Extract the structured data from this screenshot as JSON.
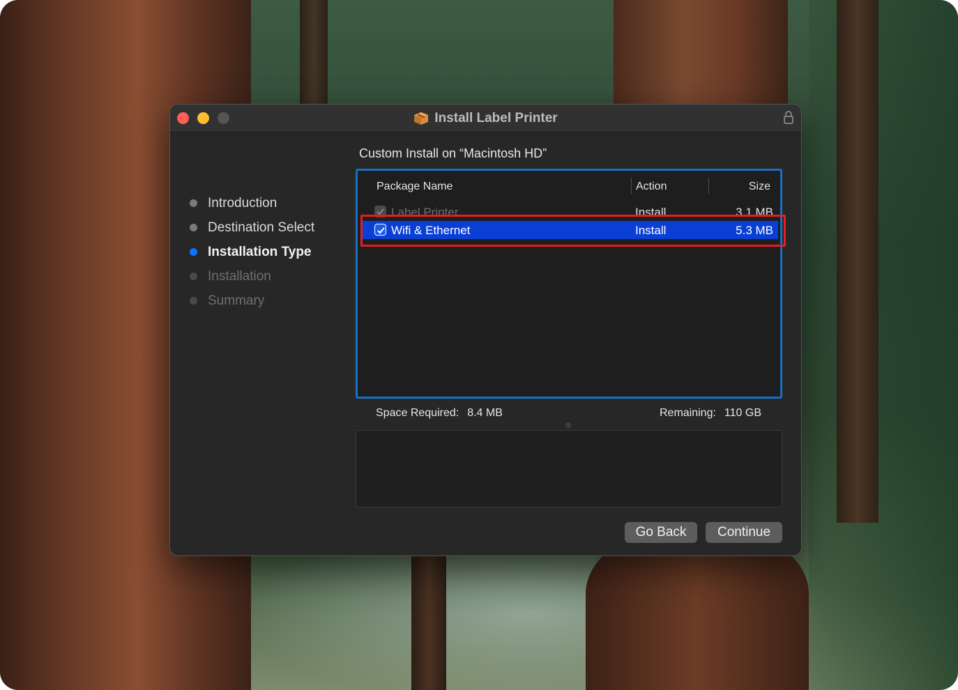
{
  "window": {
    "title": "Install Label Printer"
  },
  "sidebar": {
    "steps": [
      {
        "label": "Introduction",
        "state": "done"
      },
      {
        "label": "Destination Select",
        "state": "done"
      },
      {
        "label": "Installation Type",
        "state": "current"
      },
      {
        "label": "Installation",
        "state": "todo"
      },
      {
        "label": "Summary",
        "state": "todo"
      }
    ]
  },
  "main": {
    "heading": "Custom Install on “Macintosh HD”",
    "table": {
      "columns": [
        "Package Name",
        "Action",
        "Size"
      ],
      "rows": [
        {
          "name": "Label Printer",
          "action": "Install",
          "size": "3.1 MB",
          "checked": true,
          "enabled": false
        },
        {
          "name": "Wifi & Ethernet",
          "action": "Install",
          "size": "5.3 MB",
          "checked": true,
          "selected": true
        }
      ]
    },
    "space": {
      "required_label": "Space Required:",
      "required_value": "8.4 MB",
      "remaining_label": "Remaining:",
      "remaining_value": "110 GB"
    }
  },
  "buttons": {
    "back": "Go Back",
    "continue": "Continue"
  },
  "colors": {
    "accent_blue": "#0a74ff",
    "selection": "#0a3fd6",
    "table_border": "#1a6ec4",
    "annotation_red": "#e81e1e"
  },
  "icons": {
    "title": "package-icon",
    "lock": "lock-icon",
    "checkbox": "checkmark-icon"
  }
}
